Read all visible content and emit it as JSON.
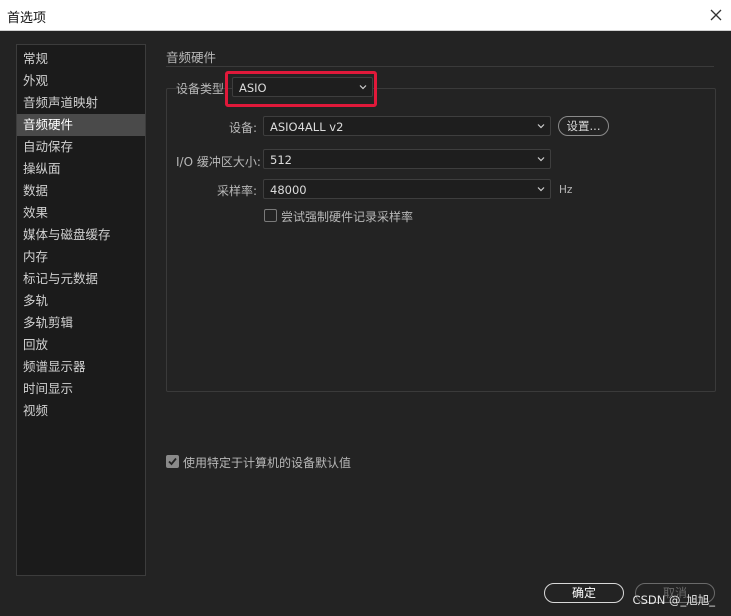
{
  "window": {
    "title": "首选项"
  },
  "sidebar": {
    "items": [
      {
        "label": "常规"
      },
      {
        "label": "外观"
      },
      {
        "label": "音频声道映射"
      },
      {
        "label": "音频硬件",
        "selected": true
      },
      {
        "label": "自动保存"
      },
      {
        "label": "操纵面"
      },
      {
        "label": "数据"
      },
      {
        "label": "效果"
      },
      {
        "label": "媒体与磁盘缓存"
      },
      {
        "label": "内存"
      },
      {
        "label": "标记与元数据"
      },
      {
        "label": "多轨"
      },
      {
        "label": "多轨剪辑"
      },
      {
        "label": "回放"
      },
      {
        "label": "频谱显示器"
      },
      {
        "label": "时间显示"
      },
      {
        "label": "视频"
      }
    ]
  },
  "main": {
    "section_title": "音频硬件",
    "device_type": {
      "label": "设备类型",
      "value": "ASIO"
    },
    "device": {
      "label": "设备:",
      "value": "ASIO4ALL v2",
      "settings_button": "设置..."
    },
    "buffer": {
      "label": "I/O 缓冲区大小:",
      "value": "512"
    },
    "sample_rate": {
      "label": "采样率:",
      "value": "48000",
      "unit": "Hz"
    },
    "force_sample_rate": {
      "label": "尝试强制硬件记录采样率",
      "checked": false
    },
    "use_machine_defaults": {
      "label": "使用特定于计算机的设备默认值",
      "checked": true
    }
  },
  "footer": {
    "ok_label": "确定",
    "cancel_label": "取消"
  },
  "watermark": "CSDN @_旭旭_",
  "colors": {
    "highlight": "#e0193a",
    "background": "#232323",
    "selected": "#4a4a4a"
  }
}
